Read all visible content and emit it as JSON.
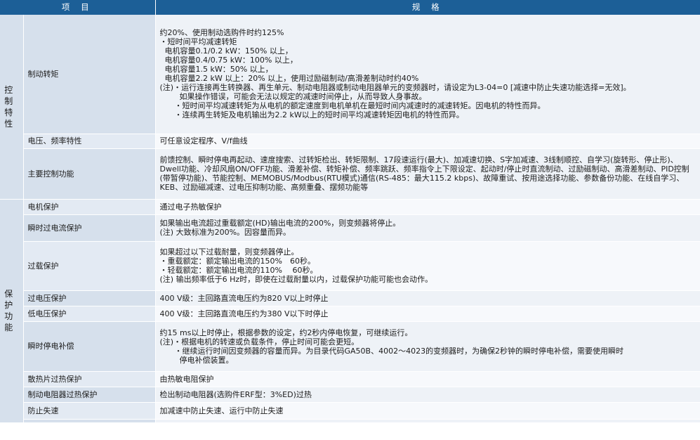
{
  "header": {
    "col_item": "项 目",
    "col_spec": "规 格"
  },
  "categories": {
    "control": "控制特性",
    "protection": "保护功能"
  },
  "control_rows": [
    {
      "item": "制动转矩",
      "spec": "约20%、使用制动选购件时约125%\n・短时间平均减速转矩\n  电机容量0.1/0.2 kW：150% 以上，\n  电机容量0.4/0.75 kW：100% 以上，\n  电机容量1.5 kW：50% 以上，\n  电机容量2.2 kW 以上：20% 以上，使用过励磁制动/高滑差制动时约40%\n(注)・运行连接再生转换器、再生单元、制动电阻器或制动电阻器单元的变频器时，请设定为L3-04=0 [减速中防止失速功能选择=无效]。\n        如果操作错误，可能会无法以规定的减速时间停止，从而导致人身事故。\n      ・短时间平均减速转矩为从电机的额定速度到电机单机在最短时间内减速时的减速转矩。因电机的特性而异。\n      ・连续再生转矩及电机输出为2.2 kW以上的短时间平均减速转矩因电机的特性而异。"
    },
    {
      "item": "电压、频率特性",
      "spec": "可任意设定程序、V/f曲线"
    },
    {
      "item": "主要控制功能",
      "spec": "前馈控制、瞬时停电再起动、速度搜索、过转矩检出、转矩限制、17段速运行(最大)、加减速切换、S字加减速、3线制顺控、自学习(旋转形、停止形)、Dwell功能、冷却风扇ON/OFF功能、滑差补偿、转矩补偿、频率跳跃、频率指令上下限设定、起动时/停止时直流制动、过励磁制动、高滑差制动、PID控制(带暂停功能)、节能控制、MEMOBUS/Modbus(RTU模式)通信(RS-485：最大115.2 kbps)、故障重试、按用途选择功能、参数备份功能、在线自学习、KEB、过励磁减速、过电压抑制功能、高频重叠、摆频功能等"
    }
  ],
  "protection_rows": [
    {
      "item": "电机保护",
      "spec": "通过电子热敏保护"
    },
    {
      "item": "瞬时过电流保护",
      "spec": "如果输出电流超过重载额定(HD)输出电流的200%，则变频器将停止。\n(注) 大致标准为200%。因容量而异。"
    },
    {
      "item": "过载保护",
      "spec": "如果超过以下过载耐量，则变频器停止。\n・重载额定：额定输出电流的150%　60秒。\n・轻载额定：额定输出电流的110%　 60秒。\n(注) 输出频率低于6 Hz时，即使在过载耐量以内，过载保护功能可能也会动作。"
    },
    {
      "item": "过电压保护",
      "spec": "400 V级：主回路直流电压约为820 V以上时停止"
    },
    {
      "item": "低电压保护",
      "spec": "400 V级：主回路直流电压约为380 V以下时停止"
    },
    {
      "item": "瞬时停电补偿",
      "spec": "约15 ms以上时停止，根据参数的设定，约2秒内停电恢复，可继续运行。\n(注)・根据电机的转速或负载条件，停止时间可能会更短。\n      ・继续运行时间因变频器的容量而异。为目录代码GA50B、4002～4023的变频器时，为确保2秒钟的瞬时停电补偿，需要使用瞬时\n        停电补偿装置。"
    },
    {
      "item": "散热片过热保护",
      "spec": "由热敏电阻保护"
    },
    {
      "item": "制动电阻器过热保护",
      "spec": "检出制动电阻器(选购件ERF型：3%ED)过热"
    },
    {
      "item": "防止失速",
      "spec": "加减速中防止失速、运行中防止失速"
    }
  ]
}
